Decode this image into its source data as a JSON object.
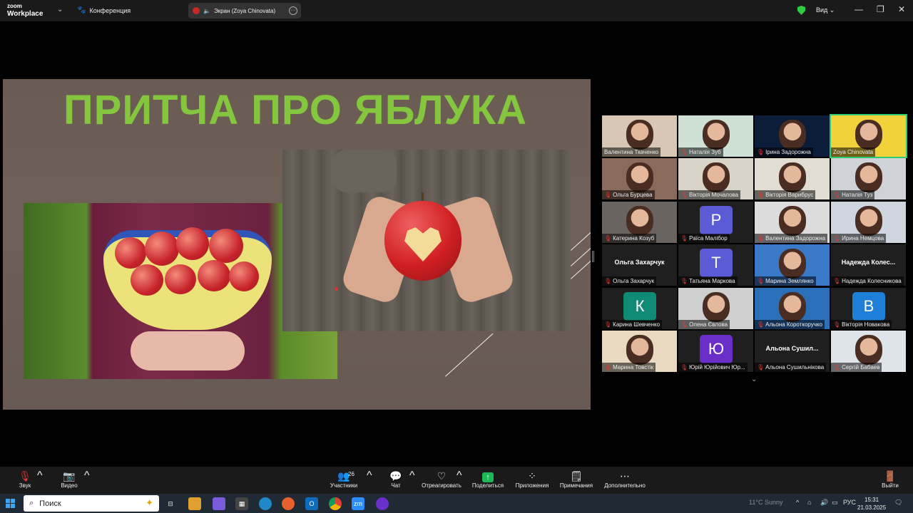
{
  "titlebar": {
    "brand_line1": "zoom",
    "brand_line2": "Workplace",
    "meeting_label": "Конференция",
    "screen_share_label": "Экран (Zoya Chinovata)",
    "view_label": "Вид"
  },
  "slide": {
    "title": "ПРИТЧА ПРО ЯБЛУКА"
  },
  "gallery": {
    "tiles": [
      {
        "name": "Валентина Ткаченко",
        "kind": "video",
        "muted": false
      },
      {
        "name": "Наталія Зуб",
        "kind": "video",
        "muted": true
      },
      {
        "name": "Ірина Задорожна",
        "kind": "video",
        "muted": true
      },
      {
        "name": "Zoya Chinovata",
        "kind": "video",
        "muted": false,
        "active": true
      },
      {
        "name": "Ольга Бурцева",
        "kind": "video",
        "muted": true
      },
      {
        "name": "Вікторія Мочалова",
        "kind": "video",
        "muted": true
      },
      {
        "name": "Вікторія Варибрус",
        "kind": "video",
        "muted": true
      },
      {
        "name": "Наталія Туз",
        "kind": "video",
        "muted": true
      },
      {
        "name": "Катерина Козуб",
        "kind": "video",
        "muted": true
      },
      {
        "name": "Раїса Малібор",
        "kind": "avatar",
        "initial": "Р",
        "color": "#5b5bd6",
        "muted": true
      },
      {
        "name": "Валентина Задорожна",
        "kind": "video",
        "muted": true
      },
      {
        "name": "Ирина Немцова",
        "kind": "video",
        "muted": true
      },
      {
        "name": "Ольга Захарчук",
        "kind": "text",
        "display": "Ольга Захарчук",
        "muted": true
      },
      {
        "name": "Татьяна Маркова",
        "kind": "avatar",
        "initial": "Т",
        "color": "#5b5bd6",
        "muted": true
      },
      {
        "name": "Марина Землянко",
        "kind": "video",
        "muted": true
      },
      {
        "name": "Надежда Колесникова",
        "kind": "text",
        "display": "Надежда Колес...",
        "muted": true
      },
      {
        "name": "Карина Шевченко",
        "kind": "avatar",
        "initial": "К",
        "color": "#0f8a74",
        "muted": true
      },
      {
        "name": "Олена Євлова",
        "kind": "video",
        "muted": true
      },
      {
        "name": "Альона Короткоручко",
        "kind": "video",
        "muted": true
      },
      {
        "name": "Вікторія Новакова",
        "kind": "avatar",
        "initial": "В",
        "color": "#1e7fd8",
        "muted": true
      },
      {
        "name": "Марина Товстік",
        "kind": "video",
        "muted": true
      },
      {
        "name": "Юрій Юрійович Юр...",
        "kind": "avatar",
        "initial": "Ю",
        "color": "#6a2fc9",
        "muted": true
      },
      {
        "name": "Альона Сушильнікова",
        "kind": "text",
        "display": "Альона Сушил...",
        "muted": true
      },
      {
        "name": "Сергій Бабаев",
        "kind": "video",
        "muted": true
      }
    ]
  },
  "toolbar": {
    "audio": "Звук",
    "video": "Видео",
    "participants": "Участники",
    "participants_count": "26",
    "chat": "Чат",
    "react": "Отреагировать",
    "share": "Поделиться",
    "apps": "Приложения",
    "notes": "Примечания",
    "more": "Дополнительно",
    "leave": "Выйти"
  },
  "taskbar": {
    "search_placeholder": "Поиск",
    "language": "РУС",
    "time": "15:31",
    "date": "21.03.2025",
    "weather": "11°C Sunny"
  },
  "colors": {
    "title_green": "#84c63e",
    "active_green": "#2ecc71",
    "mute_red": "#e53935"
  }
}
